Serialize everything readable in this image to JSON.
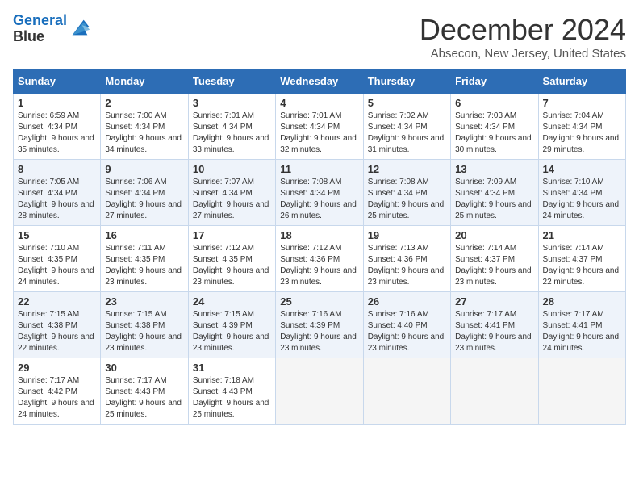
{
  "logo": {
    "line1": "General",
    "line2": "Blue"
  },
  "title": "December 2024",
  "location": "Absecon, New Jersey, United States",
  "days_of_week": [
    "Sunday",
    "Monday",
    "Tuesday",
    "Wednesday",
    "Thursday",
    "Friday",
    "Saturday"
  ],
  "weeks": [
    [
      {
        "day": "1",
        "sunrise": "6:59 AM",
        "sunset": "4:34 PM",
        "daylight": "9 hours and 35 minutes."
      },
      {
        "day": "2",
        "sunrise": "7:00 AM",
        "sunset": "4:34 PM",
        "daylight": "9 hours and 34 minutes."
      },
      {
        "day": "3",
        "sunrise": "7:01 AM",
        "sunset": "4:34 PM",
        "daylight": "9 hours and 33 minutes."
      },
      {
        "day": "4",
        "sunrise": "7:01 AM",
        "sunset": "4:34 PM",
        "daylight": "9 hours and 32 minutes."
      },
      {
        "day": "5",
        "sunrise": "7:02 AM",
        "sunset": "4:34 PM",
        "daylight": "9 hours and 31 minutes."
      },
      {
        "day": "6",
        "sunrise": "7:03 AM",
        "sunset": "4:34 PM",
        "daylight": "9 hours and 30 minutes."
      },
      {
        "day": "7",
        "sunrise": "7:04 AM",
        "sunset": "4:34 PM",
        "daylight": "9 hours and 29 minutes."
      }
    ],
    [
      {
        "day": "8",
        "sunrise": "7:05 AM",
        "sunset": "4:34 PM",
        "daylight": "9 hours and 28 minutes."
      },
      {
        "day": "9",
        "sunrise": "7:06 AM",
        "sunset": "4:34 PM",
        "daylight": "9 hours and 27 minutes."
      },
      {
        "day": "10",
        "sunrise": "7:07 AM",
        "sunset": "4:34 PM",
        "daylight": "9 hours and 27 minutes."
      },
      {
        "day": "11",
        "sunrise": "7:08 AM",
        "sunset": "4:34 PM",
        "daylight": "9 hours and 26 minutes."
      },
      {
        "day": "12",
        "sunrise": "7:08 AM",
        "sunset": "4:34 PM",
        "daylight": "9 hours and 25 minutes."
      },
      {
        "day": "13",
        "sunrise": "7:09 AM",
        "sunset": "4:34 PM",
        "daylight": "9 hours and 25 minutes."
      },
      {
        "day": "14",
        "sunrise": "7:10 AM",
        "sunset": "4:34 PM",
        "daylight": "9 hours and 24 minutes."
      }
    ],
    [
      {
        "day": "15",
        "sunrise": "7:10 AM",
        "sunset": "4:35 PM",
        "daylight": "9 hours and 24 minutes."
      },
      {
        "day": "16",
        "sunrise": "7:11 AM",
        "sunset": "4:35 PM",
        "daylight": "9 hours and 23 minutes."
      },
      {
        "day": "17",
        "sunrise": "7:12 AM",
        "sunset": "4:35 PM",
        "daylight": "9 hours and 23 minutes."
      },
      {
        "day": "18",
        "sunrise": "7:12 AM",
        "sunset": "4:36 PM",
        "daylight": "9 hours and 23 minutes."
      },
      {
        "day": "19",
        "sunrise": "7:13 AM",
        "sunset": "4:36 PM",
        "daylight": "9 hours and 23 minutes."
      },
      {
        "day": "20",
        "sunrise": "7:14 AM",
        "sunset": "4:37 PM",
        "daylight": "9 hours and 23 minutes."
      },
      {
        "day": "21",
        "sunrise": "7:14 AM",
        "sunset": "4:37 PM",
        "daylight": "9 hours and 22 minutes."
      }
    ],
    [
      {
        "day": "22",
        "sunrise": "7:15 AM",
        "sunset": "4:38 PM",
        "daylight": "9 hours and 22 minutes."
      },
      {
        "day": "23",
        "sunrise": "7:15 AM",
        "sunset": "4:38 PM",
        "daylight": "9 hours and 23 minutes."
      },
      {
        "day": "24",
        "sunrise": "7:15 AM",
        "sunset": "4:39 PM",
        "daylight": "9 hours and 23 minutes."
      },
      {
        "day": "25",
        "sunrise": "7:16 AM",
        "sunset": "4:39 PM",
        "daylight": "9 hours and 23 minutes."
      },
      {
        "day": "26",
        "sunrise": "7:16 AM",
        "sunset": "4:40 PM",
        "daylight": "9 hours and 23 minutes."
      },
      {
        "day": "27",
        "sunrise": "7:17 AM",
        "sunset": "4:41 PM",
        "daylight": "9 hours and 23 minutes."
      },
      {
        "day": "28",
        "sunrise": "7:17 AM",
        "sunset": "4:41 PM",
        "daylight": "9 hours and 24 minutes."
      }
    ],
    [
      {
        "day": "29",
        "sunrise": "7:17 AM",
        "sunset": "4:42 PM",
        "daylight": "9 hours and 24 minutes."
      },
      {
        "day": "30",
        "sunrise": "7:17 AM",
        "sunset": "4:43 PM",
        "daylight": "9 hours and 25 minutes."
      },
      {
        "day": "31",
        "sunrise": "7:18 AM",
        "sunset": "4:43 PM",
        "daylight": "9 hours and 25 minutes."
      },
      null,
      null,
      null,
      null
    ]
  ]
}
